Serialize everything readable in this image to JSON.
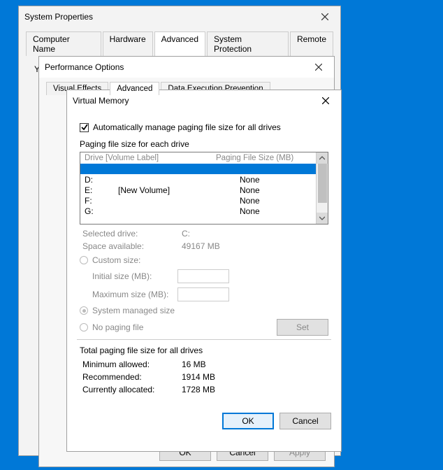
{
  "sys": {
    "title": "System Properties",
    "tabs": [
      "Computer Name",
      "Hardware",
      "Advanced",
      "System Protection",
      "Remote"
    ],
    "active_tab": 2,
    "body_prefix": "Y"
  },
  "perf": {
    "title": "Performance Options",
    "tabs": [
      "Visual Effects",
      "Advanced",
      "Data Execution Prevention"
    ],
    "active_tab": 1,
    "buttons": {
      "ok": "OK",
      "cancel": "Cancel",
      "apply": "Apply"
    }
  },
  "vm": {
    "title": "Virtual Memory",
    "auto_manage_checked": true,
    "auto_manage_label": "Automatically manage paging file size for all drives",
    "group_label": "Paging file size for each drive",
    "col_drive": "Drive  [Volume Label]",
    "col_pfs": "Paging File Size (MB)",
    "drives": [
      {
        "letter": "",
        "label": "",
        "pfs": "",
        "selected": true
      },
      {
        "letter": "D:",
        "label": "",
        "pfs": "None"
      },
      {
        "letter": "E:",
        "label": "[New Volume]",
        "pfs": "None"
      },
      {
        "letter": "F:",
        "label": "",
        "pfs": "None"
      },
      {
        "letter": "G:",
        "label": "",
        "pfs": "None"
      }
    ],
    "selected_drive_label": "Selected drive:",
    "selected_drive_value": "C:",
    "space_avail_label": "Space available:",
    "space_avail_value": "49167 MB",
    "custom_size_label": "Custom size:",
    "initial_size_label": "Initial size (MB):",
    "max_size_label": "Maximum size (MB):",
    "sys_managed_label": "System managed size",
    "no_paging_label": "No paging file",
    "set_button": "Set",
    "total_header": "Total paging file size for all drives",
    "min_allowed_label": "Minimum allowed:",
    "min_allowed_value": "16 MB",
    "recommended_label": "Recommended:",
    "recommended_value": "1914 MB",
    "current_label": "Currently allocated:",
    "current_value": "1728 MB",
    "ok": "OK",
    "cancel": "Cancel"
  }
}
